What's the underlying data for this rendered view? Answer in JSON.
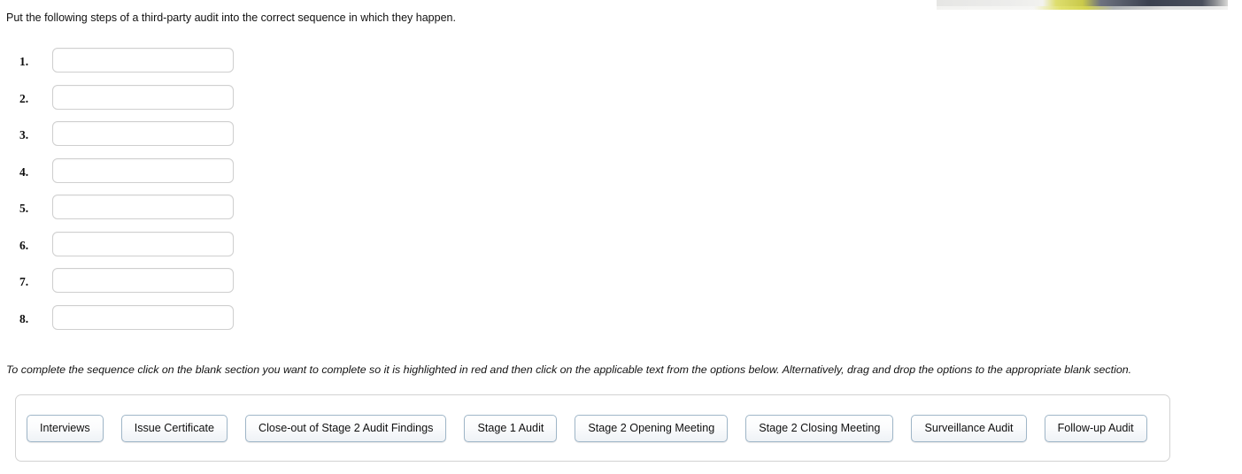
{
  "prompt": {
    "text": "Put the following steps of a third-party audit into the correct sequence in which they happen."
  },
  "answer_rows": [
    {
      "number": "1.",
      "value": "",
      "placeholder": ""
    },
    {
      "number": "2.",
      "value": "",
      "placeholder": ""
    },
    {
      "number": "3.",
      "value": "",
      "placeholder": ""
    },
    {
      "number": "4.",
      "value": "",
      "placeholder": ""
    },
    {
      "number": "5.",
      "value": "",
      "placeholder": ""
    },
    {
      "number": "6.",
      "value": "",
      "placeholder": ""
    },
    {
      "number": "7.",
      "value": "",
      "placeholder": ""
    },
    {
      "number": "8.",
      "value": "",
      "placeholder": ""
    }
  ],
  "instructions": {
    "text": "To complete the sequence click on the blank section you want to complete so it is highlighted in red and then click on the applicable text from the options below. Alternatively, drag and drop the options to the appropriate blank section."
  },
  "options": [
    {
      "label": "Interviews"
    },
    {
      "label": "Issue Certificate"
    },
    {
      "label": "Close-out of Stage 2 Audit Findings"
    },
    {
      "label": "Stage 1 Audit"
    },
    {
      "label": "Stage 2 Opening Meeting"
    },
    {
      "label": "Stage 2 Closing Meeting"
    },
    {
      "label": "Surveillance Audit"
    },
    {
      "label": "Follow-up Audit"
    }
  ],
  "media": {
    "top_right_photo": "cropped-photo-strip"
  },
  "colors": {
    "page_background": "#ffffff",
    "text": "#111111",
    "blank_border": "#cfcfcf",
    "tray_border": "#d2d2d2",
    "chip_border": "#9fb6c8",
    "chip_fill_top": "#ffffff",
    "chip_fill_bottom": "#eef2f6",
    "highlight_selected": "#ff0000"
  }
}
